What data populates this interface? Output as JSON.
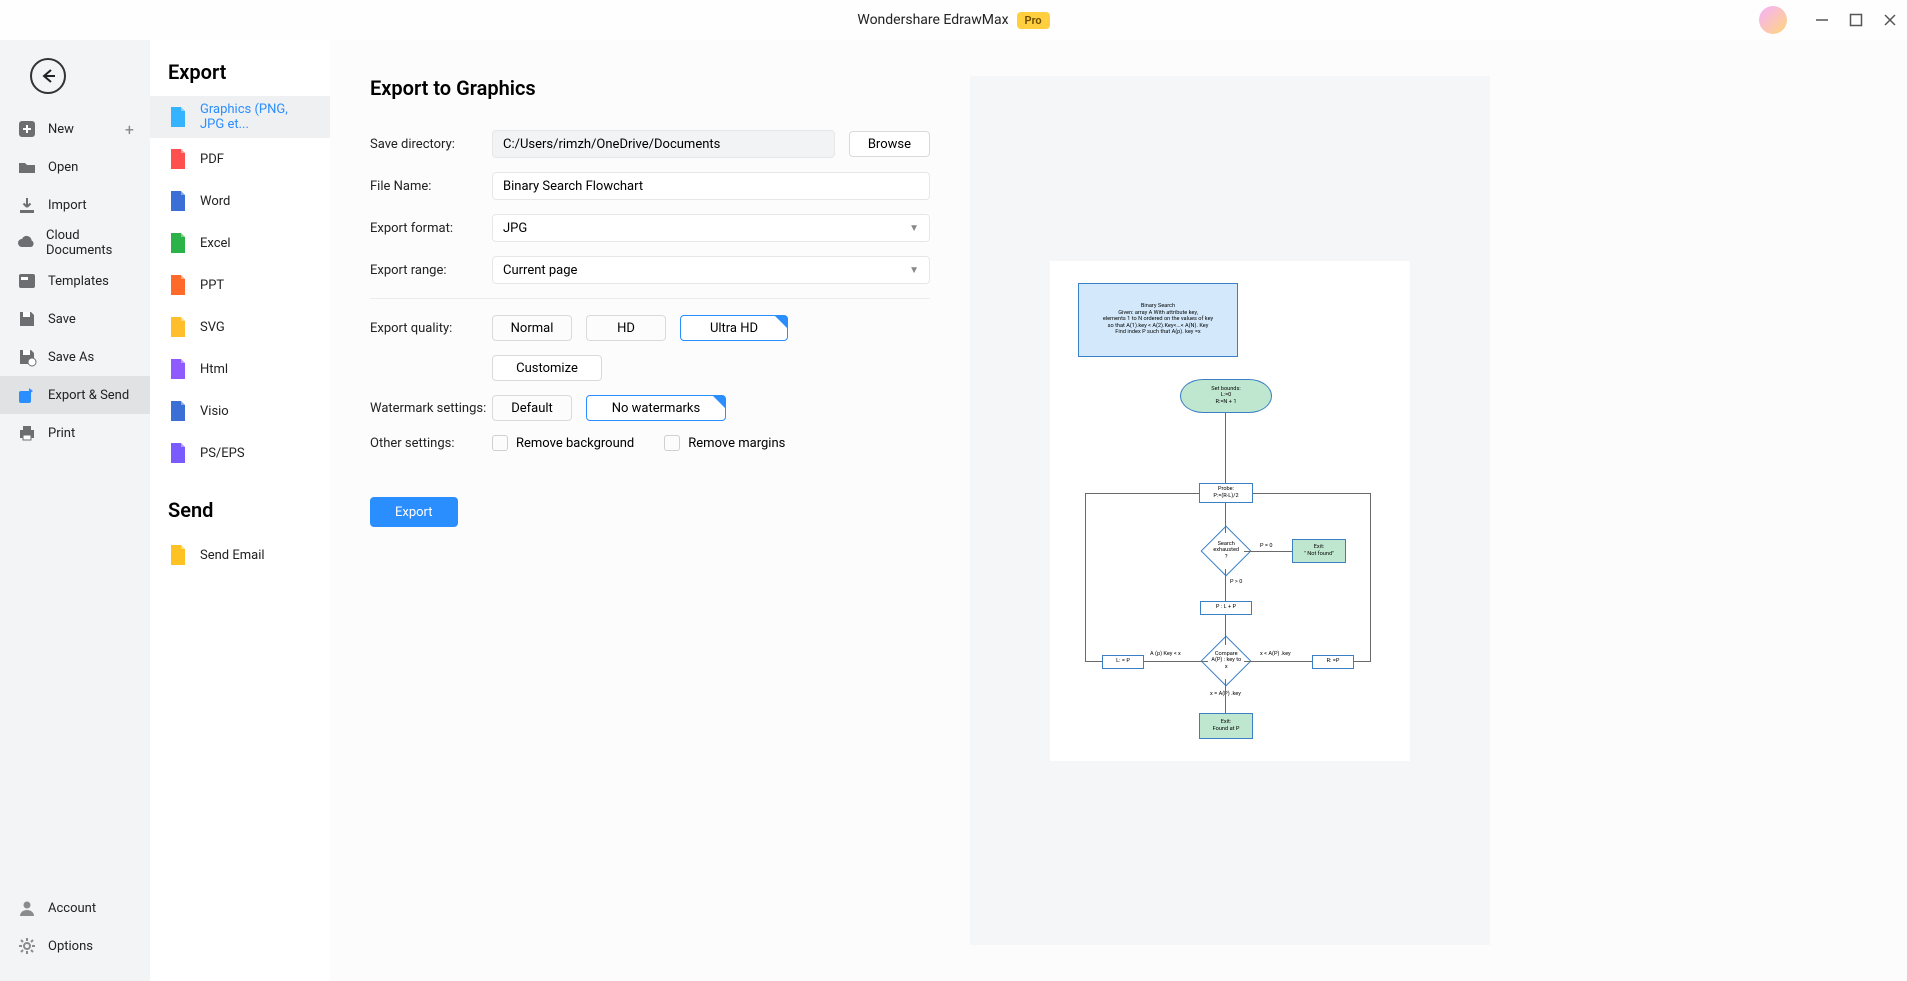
{
  "app": {
    "title": "Wondershare EdrawMax",
    "badge": "Pro"
  },
  "sidebar1": {
    "items": [
      {
        "label": "New",
        "icon": "plus-square",
        "trailingPlus": true
      },
      {
        "label": "Open",
        "icon": "folder"
      },
      {
        "label": "Import",
        "icon": "download"
      },
      {
        "label": "Cloud Documents",
        "icon": "cloud"
      },
      {
        "label": "Templates",
        "icon": "template"
      },
      {
        "label": "Save",
        "icon": "save"
      },
      {
        "label": "Save As",
        "icon": "save-as"
      },
      {
        "label": "Export & Send",
        "icon": "export",
        "active": true
      },
      {
        "label": "Print",
        "icon": "printer"
      }
    ],
    "bottom": [
      {
        "label": "Account",
        "icon": "user"
      },
      {
        "label": "Options",
        "icon": "gear"
      }
    ]
  },
  "sidebar2": {
    "exportHeading": "Export",
    "exportItems": [
      {
        "label": "Graphics (PNG, JPG et...",
        "color": "#35b3ff",
        "active": true
      },
      {
        "label": "PDF",
        "color": "#ff5050"
      },
      {
        "label": "Word",
        "color": "#3b6fd6"
      },
      {
        "label": "Excel",
        "color": "#2bb34a"
      },
      {
        "label": "PPT",
        "color": "#ff6a2b"
      },
      {
        "label": "SVG",
        "color": "#ffbe2b"
      },
      {
        "label": "Html",
        "color": "#8f5bff"
      },
      {
        "label": "Visio",
        "color": "#3b6fd6"
      },
      {
        "label": "PS/EPS",
        "color": "#7a5bff"
      }
    ],
    "sendHeading": "Send",
    "sendItems": [
      {
        "label": "Send Email",
        "color": "#ffc225"
      }
    ]
  },
  "form": {
    "heading": "Export to Graphics",
    "labels": {
      "saveDir": "Save directory:",
      "fileName": "File Name:",
      "format": "Export format:",
      "range": "Export range:",
      "quality": "Export quality:",
      "watermark": "Watermark settings:",
      "other": "Other settings:"
    },
    "values": {
      "saveDir": "C:/Users/rimzh/OneDrive/Documents",
      "fileName": "Binary Search Flowchart",
      "format": "JPG",
      "range": "Current page"
    },
    "buttons": {
      "browse": "Browse",
      "customize": "Customize",
      "export": "Export"
    },
    "quality": {
      "options": [
        "Normal",
        "HD",
        "Ultra HD"
      ],
      "selected": "Ultra HD"
    },
    "watermark": {
      "options": [
        "Default",
        "No watermarks"
      ],
      "selected": "No watermarks"
    },
    "other": {
      "removeBg": {
        "label": "Remove background",
        "checked": false
      },
      "removeMarg": {
        "label": "Remove margins",
        "checked": false
      }
    }
  },
  "preview": {
    "nodes": {
      "start": "Binary Search\nGiven: array A With attribute key,\nelements 1 to N ordered on the values of key\nso that A(1).key < A(2).Key<...< A(N). Key\nFind index P such that A(p). key =x",
      "bounds": "Set bounds:\nL:=0\nR:=N + 1",
      "probe": "Probe:\nP:=(R-L)/2",
      "search": "Search\nexhausted\n?",
      "exitNF": "Exit:\n\" Not found\"",
      "plp": "P : L + P",
      "compare": "Compare\nA(P) : key to x",
      "lp": "L: = P",
      "rp": "R: =P",
      "exitF": "Exit:\nFound at P",
      "lblP0": "P = 0",
      "lblPg0": "P > 0",
      "lblLt": "A (p) Key < x",
      "lblGt": "x < A(P) .key",
      "lblEq": "x = A(P) .key"
    }
  }
}
